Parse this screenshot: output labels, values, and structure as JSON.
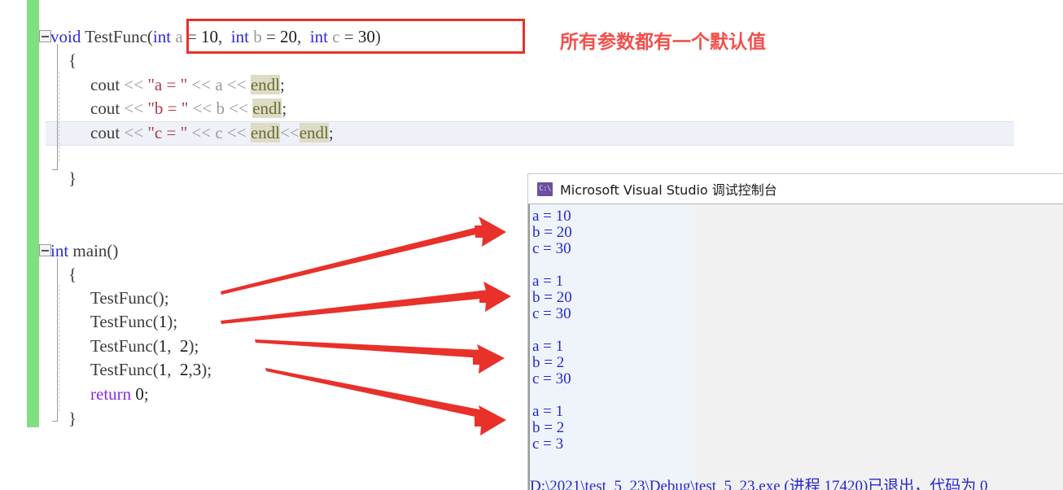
{
  "editor": {
    "lines": [
      {
        "id": "func-signature",
        "text": "void TestFunc(int a = 10, int b = 20, int c = 30)"
      },
      {
        "id": "func-open-brace",
        "text": "{"
      },
      {
        "id": "cout-a",
        "text": "cout << \"a = \" << a << endl;"
      },
      {
        "id": "cout-b",
        "text": "cout << \"b = \" << b << endl;"
      },
      {
        "id": "cout-c",
        "text": "cout << \"c = \" << c << endl<<endl;"
      },
      {
        "id": "func-close-brace",
        "text": "}"
      },
      {
        "id": "main-signature",
        "text": "int main()"
      },
      {
        "id": "main-open-brace",
        "text": "{"
      },
      {
        "id": "call-1",
        "text": "TestFunc();"
      },
      {
        "id": "call-2",
        "text": "TestFunc(1);"
      },
      {
        "id": "call-3",
        "text": "TestFunc(1, 2);"
      },
      {
        "id": "call-4",
        "text": "TestFunc(1, 2,3);"
      },
      {
        "id": "return-stmt",
        "text": "return 0;"
      },
      {
        "id": "main-close-brace",
        "text": "}"
      }
    ],
    "tokens": {
      "kw_void": "void",
      "kw_int": "int",
      "kw_return": "return",
      "fn_testfunc": "TestFunc",
      "fn_main": "main",
      "cout": "cout",
      "endl": "endl",
      "shift_op": "<<",
      "str_a": "\"a = \"",
      "str_b": "\"b = \"",
      "str_c": "\"c = \"",
      "var_a": "a",
      "var_b": "b",
      "var_c": "c",
      "num_10": "10",
      "num_20": "20",
      "num_30": "30",
      "num_0": "0",
      "num_1": "1",
      "num_2": "2",
      "num_3": "3",
      "semicolon": ";",
      "comma": ",",
      "open_paren": "(",
      "close_paren": ")",
      "equals": "=",
      "open_brace": "{",
      "close_brace": "}"
    },
    "colors": {
      "keyword": "#2b2bd8",
      "string": "#b03a48",
      "endl_highlight": "#dddcc4",
      "track_changes_bar": "#7fe07f",
      "current_line": "#eef1f7"
    }
  },
  "annotation": {
    "text": "所有参数都有一个默认值",
    "color": "#f2504b"
  },
  "param_box": {
    "label": "int a = 10, int b = 20, int c = 30",
    "border_color": "#e8312a"
  },
  "console": {
    "title": "Microsoft Visual Studio 调试控制台",
    "icon_label": "C:\\",
    "icon_color": "#6b4fa0",
    "text_color": "#2727c8",
    "output_blocks": [
      [
        "a = 10",
        "b = 20",
        "c = 30"
      ],
      [
        "a = 1",
        "b = 20",
        "c = 30"
      ],
      [
        "a = 1",
        "b = 2",
        "c = 30"
      ],
      [
        "a = 1",
        "b = 2",
        "c = 3"
      ]
    ],
    "exit_line": "D:\\2021\\test_5_23\\Debug\\test_5_23.exe (进程 17420)已退出，代码为 0"
  },
  "arrows": {
    "color": "#e8312a",
    "items": [
      {
        "name": "arrow-call-1",
        "from_call": "TestFunc();",
        "to_block": 0
      },
      {
        "name": "arrow-call-2",
        "from_call": "TestFunc(1);",
        "to_block": 1
      },
      {
        "name": "arrow-call-3",
        "from_call": "TestFunc(1, 2);",
        "to_block": 2
      },
      {
        "name": "arrow-call-4",
        "from_call": "TestFunc(1, 2,3);",
        "to_block": 3
      }
    ]
  }
}
